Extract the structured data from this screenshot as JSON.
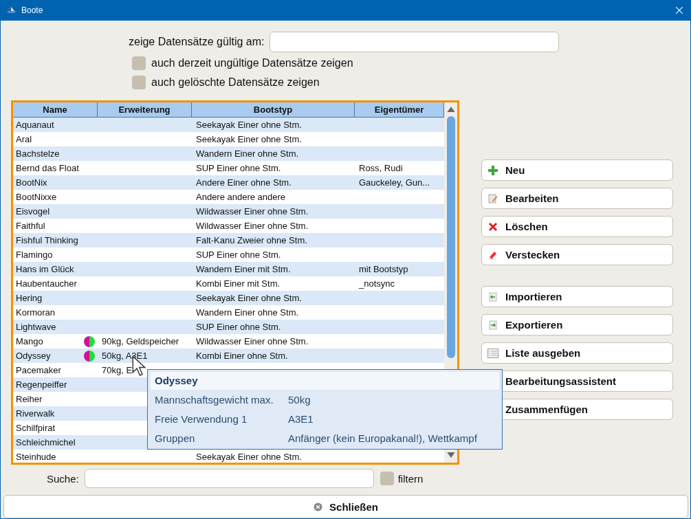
{
  "window": {
    "title": "Boote"
  },
  "filter": {
    "date_label": "zeige Datensätze gültig am:",
    "options": [
      {
        "label": "auch derzeit ungültige Datensätze zeigen",
        "checked": false
      },
      {
        "label": "auch gelöschte Datensätze zeigen",
        "checked": false
      }
    ]
  },
  "table": {
    "columns": [
      "Name",
      "Erweiterung",
      "Bootstyp",
      "Eigentümer"
    ],
    "rows": [
      {
        "name": "Aquanaut",
        "bootstyp": "Seekayak Einer ohne Stm."
      },
      {
        "name": "Aral",
        "bootstyp": "Seekayak Einer ohne Stm."
      },
      {
        "name": "Bachstelze",
        "bootstyp": "Wandern Einer ohne Stm."
      },
      {
        "name": "Bernd das Float",
        "bootstyp": "SUP Einer ohne Stm.",
        "owner": "Ross, Rudi"
      },
      {
        "name": "BootNix",
        "bootstyp": "Andere Einer ohne Stm.",
        "owner": "Gauckeley, Gun..."
      },
      {
        "name": "BootNixxe",
        "bootstyp": "Andere andere andere"
      },
      {
        "name": "Eisvogel",
        "bootstyp": "Wildwasser Einer ohne Stm."
      },
      {
        "name": "Faithful",
        "bootstyp": "Wildwasser Einer ohne Stm."
      },
      {
        "name": "Fishful Thinking",
        "bootstyp": "Falt-Kanu Zweier ohne Stm."
      },
      {
        "name": "Flamingo",
        "bootstyp": "SUP Einer ohne Stm."
      },
      {
        "name": "Hans im Glück",
        "bootstyp": "Wandern Einer mit Stm.",
        "owner": "mit Bootstyp"
      },
      {
        "name": "Haubentaucher",
        "bootstyp": "Kombi Einer mit Stm.",
        "owner": "_notsync"
      },
      {
        "name": "Hering",
        "bootstyp": "Seekayak Einer ohne Stm."
      },
      {
        "name": "Kormoran",
        "bootstyp": "Wandern Einer ohne Stm."
      },
      {
        "name": "Lightwave",
        "bootstyp": "SUP Einer ohne Stm."
      },
      {
        "name": "Mango",
        "groups": [
          {
            "color": "#d0119a"
          },
          {
            "color": "#22dd3a"
          }
        ],
        "extension": "90kg, Geldspeicher",
        "bootstyp": "Wildwasser Einer ohne Stm."
      },
      {
        "name": "Odyssey",
        "groups": [
          {
            "color": "#d0119a"
          },
          {
            "color": "#22dd3a"
          }
        ],
        "extension": "50kg, A3E1",
        "bootstyp": "Kombi Einer ohne Stm."
      },
      {
        "name": "Pacemaker",
        "extension": "70kg, E"
      },
      {
        "name": "Regenpeiffer"
      },
      {
        "name": "Reiher"
      },
      {
        "name": "Riverwalk"
      },
      {
        "name": "Schilfpirat"
      },
      {
        "name": "Schleichmichel"
      },
      {
        "name": "Steinhude",
        "bootstyp": "Seekayak Einer ohne Stm."
      }
    ]
  },
  "tooltip": {
    "title": "Odyssey",
    "rows": [
      {
        "label": "Mannschaftsgewicht max.",
        "value": "50kg"
      },
      {
        "label": "Freie Verwendung 1",
        "value": "A3E1"
      },
      {
        "label": "Gruppen",
        "value": "Anfänger (kein Europakanal!), Wettkampf"
      }
    ]
  },
  "action_groups": [
    {
      "buttons": [
        {
          "label": "Neu",
          "kind": "plus"
        },
        {
          "label": "Bearbeiten",
          "kind": "edit"
        },
        {
          "label": "Löschen",
          "kind": "delete"
        },
        {
          "label": "Verstecken",
          "kind": "eraser"
        }
      ]
    },
    {
      "buttons": [
        {
          "label": "Importieren",
          "kind": "import"
        },
        {
          "label": "Exportieren",
          "kind": "export"
        },
        {
          "label": "Liste ausgeben",
          "kind": "list"
        },
        {
          "label": "Bearbeitungsassistent"
        },
        {
          "label": "Zusammenfügen"
        }
      ]
    }
  ],
  "search": {
    "label": "Suche:",
    "filter": {
      "label": "filtern",
      "checked": false
    }
  },
  "close_button": {
    "label": "Schließen"
  }
}
